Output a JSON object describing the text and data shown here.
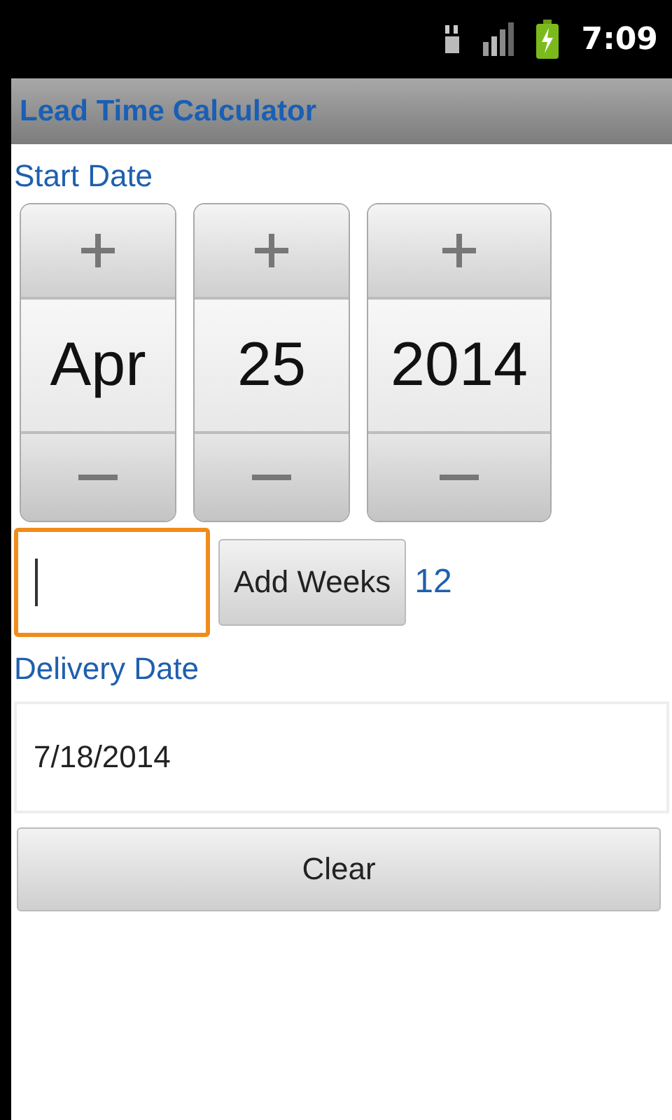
{
  "status_bar": {
    "time": "7:09"
  },
  "title_bar": {
    "title": "Lead Time Calculator"
  },
  "start_date": {
    "label": "Start Date",
    "spinners": [
      {
        "value": "Apr"
      },
      {
        "value": "25"
      },
      {
        "value": "2014"
      }
    ]
  },
  "weeks": {
    "field": {
      "focused": true
    },
    "button": "Add Weeks",
    "result": "12"
  },
  "delivery_date": {
    "label": "Delivery Date",
    "value": "7/18/2014"
  },
  "clear_button": "Clear"
}
